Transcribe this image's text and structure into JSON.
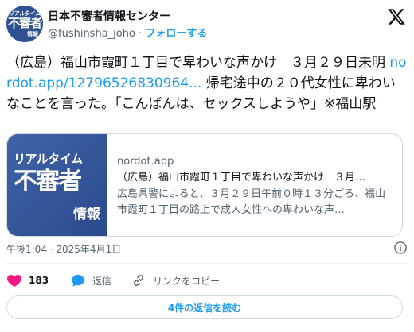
{
  "account": {
    "avatar_text_top": "リアルタイム",
    "avatar_text_mid": "不審者",
    "avatar_text_bot": "情報",
    "name": "日本不審者情報センター",
    "handle": "@fushinsha_joho",
    "separator": "·",
    "follow_label": "フォローする"
  },
  "icons": {
    "platform_logo": "x-logo-icon",
    "info": "info-icon",
    "like": "heart-icon",
    "reply": "reply-bubble-icon",
    "copy_link": "link-icon"
  },
  "tweet": {
    "text_before_link": "（広島）福山市霞町１丁目で卑わいな声かけ　３月２９日未明 ",
    "link_text": "nordot.app/12796526830964...",
    "text_after_link": " 帰宅途中の２０代女性に卑わいなことを言った。「こんばんは、セックスしようや」※福山駅"
  },
  "card": {
    "image_text_top": "リアルタイム",
    "image_text_mid": "不審者",
    "image_text_bot": "情報",
    "domain": "nordot.app",
    "title": "（広島）福山市霞町１丁目で卑わいな声かけ　３月…",
    "description": "広島県警によると、３月２９日午前０時１３分ごろ、福山市霞町１丁目の路上で成人女性への卑わいな声…"
  },
  "meta": {
    "timestamp": "午後1:04 · 2025年4月1日"
  },
  "actions": {
    "like_count": "183",
    "reply_label": "返信",
    "copy_link_label": "リンクをコピー"
  },
  "footer": {
    "read_replies_label": "4件の返信を読む"
  },
  "colors": {
    "accent": "#1d9bf0",
    "like": "#f91880",
    "text": "#0f1419",
    "muted": "#536471",
    "avatar_bg": "#2f5192"
  }
}
